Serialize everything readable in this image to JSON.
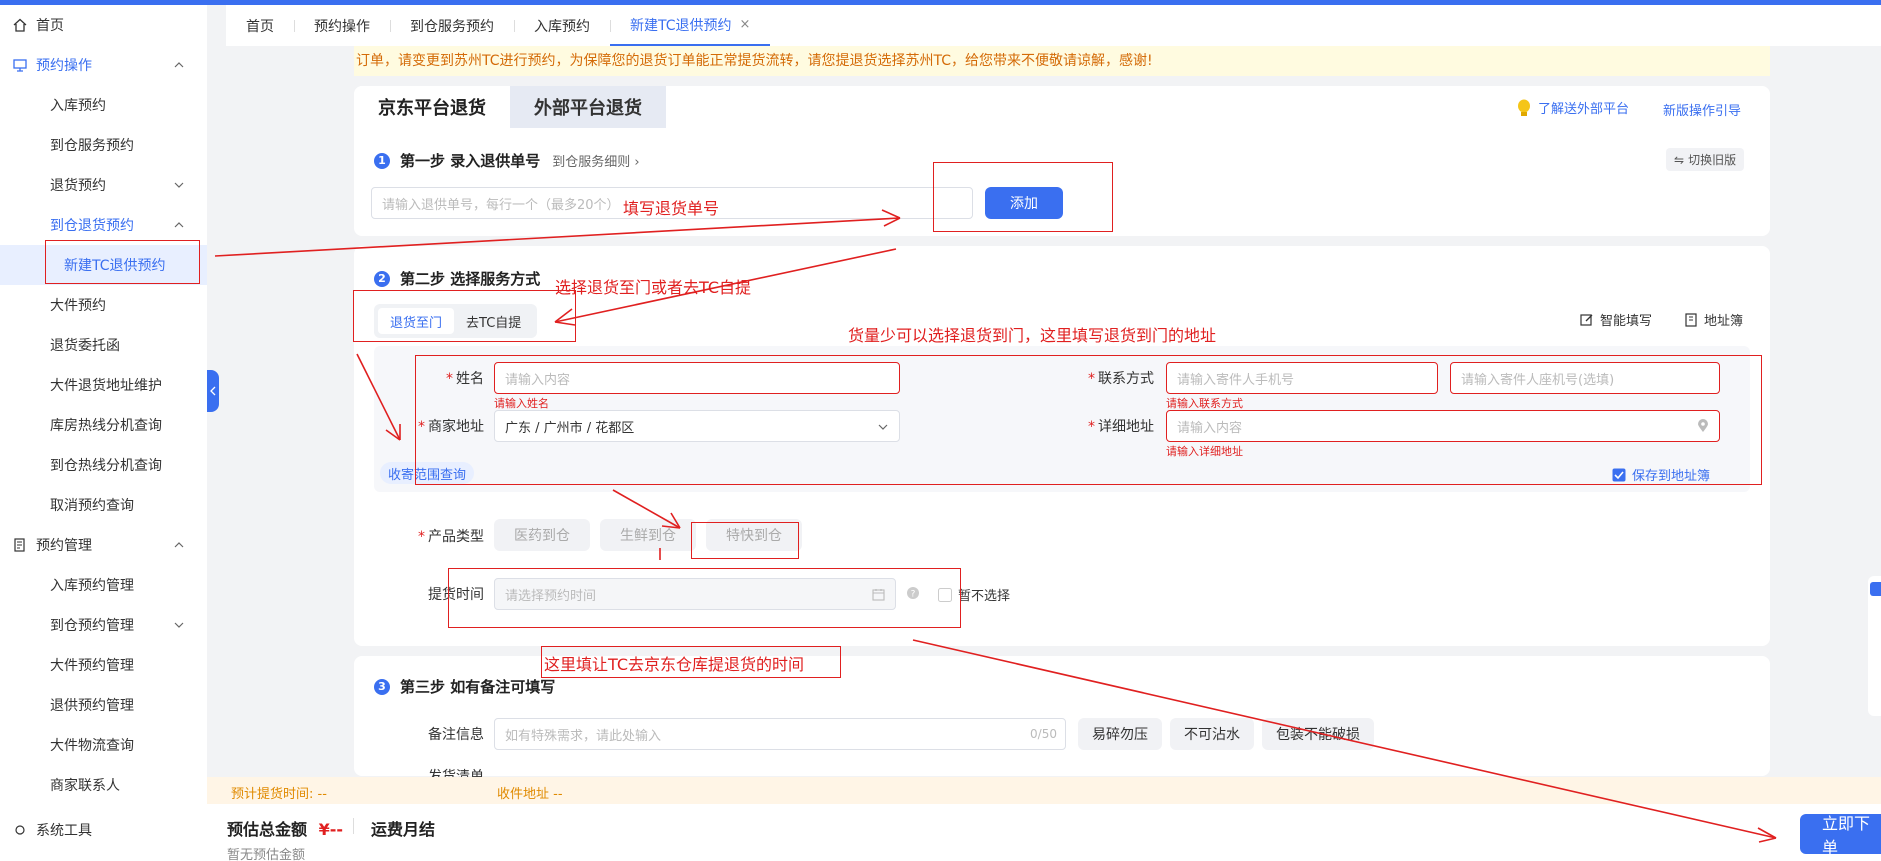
{
  "sidebar": {
    "home": "首页",
    "booking_ops": "预约操作",
    "inbound_booking": "入库预约",
    "to_warehouse_service": "到仓服务预约",
    "return_booking": "退货预约",
    "to_warehouse_return": "到仓退货预约",
    "new_tc_return": "新建TC退供预约",
    "large_booking": "大件预约",
    "return_delegation": "退货委托函",
    "large_return_address": "大件退货地址维护",
    "warehouse_hotline": "库房热线分机查询",
    "to_warehouse_hotline": "到仓热线分机查询",
    "cancel_booking": "取消预约查询",
    "booking_mgmt": "预约管理",
    "inbound_mgmt": "入库预约管理",
    "to_warehouse_mgmt": "到仓预约管理",
    "large_mgmt": "大件预约管理",
    "return_supply_mgmt": "退供预约管理",
    "large_logistics": "大件物流查询",
    "merchant_contact": "商家联系人",
    "system_tools": "系统工具"
  },
  "tabs": [
    {
      "label": "首页"
    },
    {
      "label": "预约操作"
    },
    {
      "label": "到仓服务预约"
    },
    {
      "label": "入库预约"
    },
    {
      "label": "新建TC退供预约"
    }
  ],
  "tab_close": "×",
  "notice": "订单，请变更到苏州TC进行预约，为保障您的退货订单能正常提货流转，请您提退货选择苏州TC，给您带来不便敬请谅解，感谢!",
  "platform_tabs": {
    "jd": "京东平台退货",
    "external": "外部平台退货"
  },
  "top_links": {
    "learn_external": "了解送外部平台",
    "new_guide": "新版操作引导",
    "switch_old": "切换旧版"
  },
  "step1": {
    "num": "1",
    "title": "第一步 录入退供单号",
    "link": "到仓服务细则",
    "placeholder": "请输入退供单号，每行一个（最多20个）",
    "add_button": "添加"
  },
  "step2": {
    "num": "2",
    "title": "第二步 选择服务方式",
    "seg_home": "退货至门",
    "seg_tc": "去TC自提",
    "smart_fill": "智能填写",
    "address_book": "地址簿",
    "name_label": "姓名",
    "name_placeholder": "请输入内容",
    "name_error": "请输入姓名",
    "contact_label": "联系方式",
    "phone_placeholder": "请输入寄件人手机号",
    "landline_placeholder": "请输入寄件人座机号(选填)",
    "contact_error": "请输入联系方式",
    "merchant_addr_label": "商家地址",
    "merchant_addr_value": "广东 / 广州市 / 花都区",
    "detail_addr_label": "详细地址",
    "detail_addr_placeholder": "请输入内容",
    "detail_addr_error": "请输入详细地址",
    "range_query": "收寄范围查询",
    "save_to_book": "保存到地址簿",
    "product_label": "产品类型",
    "products": [
      "医药到仓",
      "生鲜到仓",
      "特快到仓"
    ],
    "pickup_label": "提货时间",
    "pickup_placeholder": "请选择预约时间",
    "no_select": "暂不选择"
  },
  "step3": {
    "num": "3",
    "title": "第三步 如有备注可填写",
    "remark_label": "备注信息",
    "remark_placeholder": "如有特殊需求，请此处输入",
    "remark_count": "0/50",
    "tags": [
      "易碎勿压",
      "不可沾水",
      "包装不能破损"
    ],
    "ship_list_label": "发货清单"
  },
  "footer": {
    "est_pickup_label": "预计提货时间:",
    "est_pickup_value": "--",
    "receive_addr_label": "收件地址",
    "receive_addr_value": "--",
    "total_label": "预估总金额",
    "total_value": "¥--",
    "freight": "运费月结",
    "no_estimate": "暂无预估金额",
    "submit": "立即下单"
  },
  "annotations": {
    "fill_return_no": "填写退货单号",
    "choose_mode": "选择退货至门或者去TC自提",
    "small_goods": "货量少可以选择退货到门，这里填写退货到门的地址",
    "pickup_time": "这里填让TC去京东仓库提退货的时间"
  },
  "colors": {
    "accent": "#3a6ff0",
    "annotation": "#e02020",
    "notice_bg": "#fffbe0"
  }
}
